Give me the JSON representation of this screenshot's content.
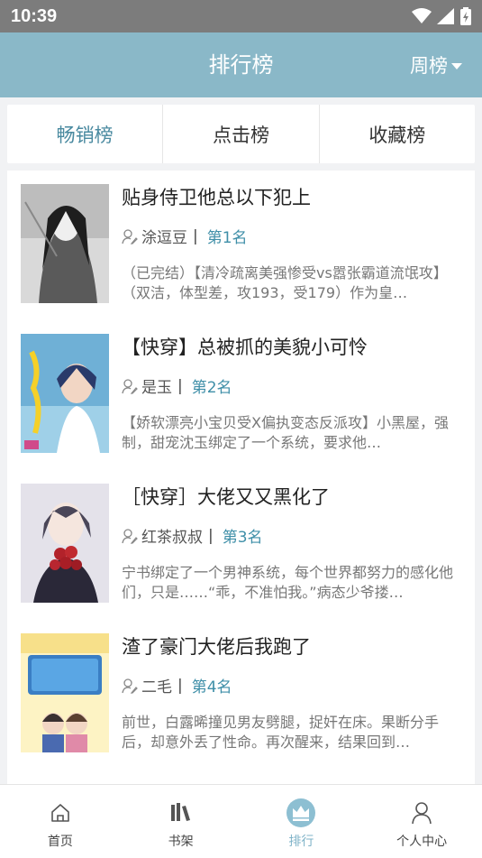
{
  "status_bar": {
    "time": "10:39"
  },
  "header": {
    "title": "排行榜",
    "period": "周榜"
  },
  "tabs": [
    {
      "label": "畅销榜",
      "active": true
    },
    {
      "label": "点击榜",
      "active": false
    },
    {
      "label": "收藏榜",
      "active": false
    }
  ],
  "books": [
    {
      "title": "贴身侍卫他总以下犯上",
      "author": "涂逗豆",
      "rank": "第1名",
      "desc": "（已完结）【清冷疏离美强惨受vs嚣张霸道流氓攻】（双洁，体型差，攻193，受179）作为皇…"
    },
    {
      "title": "【快穿】总被抓的美貌小可怜",
      "author": "是玉",
      "rank": "第2名",
      "desc": "【娇软漂亮小宝贝受X偏执变态反派攻】小黑屋，强制，甜宠沈玉绑定了一个系统，要求他…"
    },
    {
      "title": "［快穿］大佬又又黑化了",
      "author": "红茶叔叔",
      "rank": "第3名",
      "desc": "宁书绑定了一个男神系统，每个世界都努力的感化他们，只是……“乖，不准怕我。”病态少爷搂…"
    },
    {
      "title": "渣了豪门大佬后我跑了",
      "author": "二毛",
      "rank": "第4名",
      "desc": "前世，白露晞撞见男友劈腿，捉奸在床。果断分手后，却意外丢了性命。再次醒来，结果回到…"
    }
  ],
  "bottom_nav": [
    {
      "label": "首页",
      "icon": "home-icon",
      "active": false
    },
    {
      "label": "书架",
      "icon": "bookshelf-icon",
      "active": false
    },
    {
      "label": "排行",
      "icon": "crown-icon",
      "active": true
    },
    {
      "label": "个人中心",
      "icon": "person-icon",
      "active": false
    }
  ],
  "colors": {
    "header": "#8ab8c8",
    "accent": "#4a8aa0",
    "rank": "#3f8fa8",
    "nav_active": "#7fb3c8"
  }
}
